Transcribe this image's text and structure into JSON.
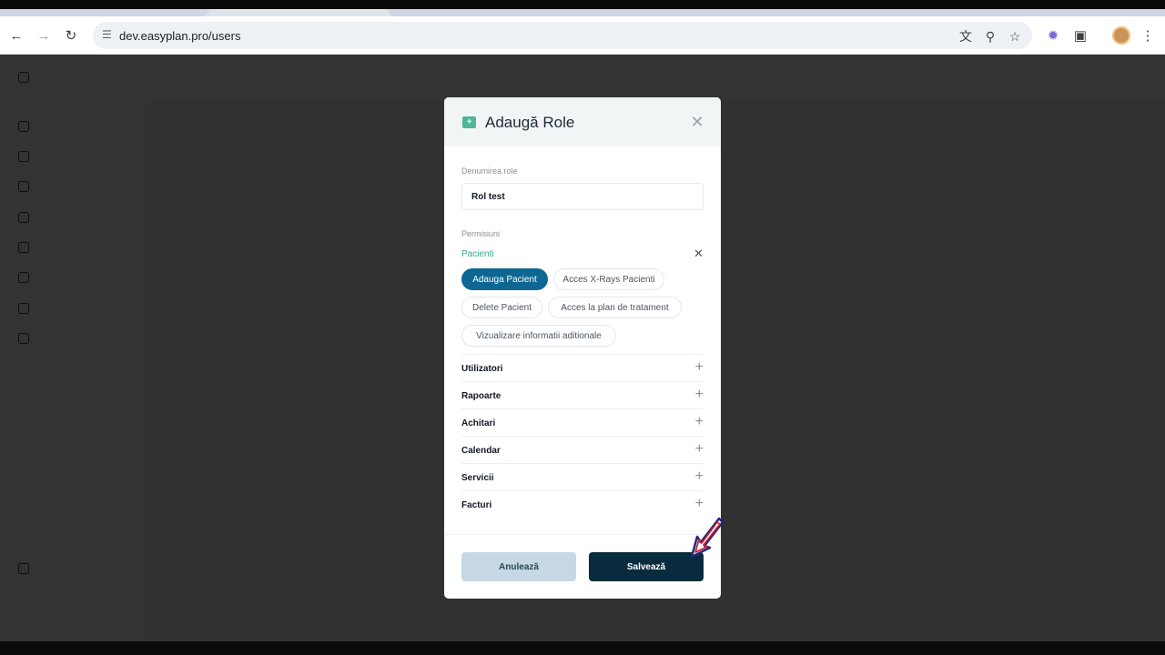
{
  "browser": {
    "url": "dev.easyplan.pro/users"
  },
  "modal": {
    "title": "Adaugă Role",
    "role_name_label": "Denumirea role",
    "role_name_value": "Rol test",
    "permissions_label": "Permisiuni",
    "section": {
      "title": "Pacienti",
      "chips": [
        {
          "label": "Adauga Pacient",
          "active": true
        },
        {
          "label": "Acces X-Rays Pacienti",
          "active": false
        },
        {
          "label": "Delete Pacient",
          "active": false
        },
        {
          "label": "Acces la plan de tratament",
          "active": false
        },
        {
          "label": "Vizualizare informatii aditionale",
          "active": false
        }
      ]
    },
    "groups": [
      "Utilizatori",
      "Rapoarte",
      "Achitari",
      "Calendar",
      "Servicii",
      "Facturi"
    ],
    "cancel_label": "Anulează",
    "save_label": "Salvează"
  },
  "colors": {
    "accent": "#0e6793",
    "save_button": "#082b3d",
    "cancel_button": "#c5d8e3",
    "section_title": "#3aa88a"
  }
}
